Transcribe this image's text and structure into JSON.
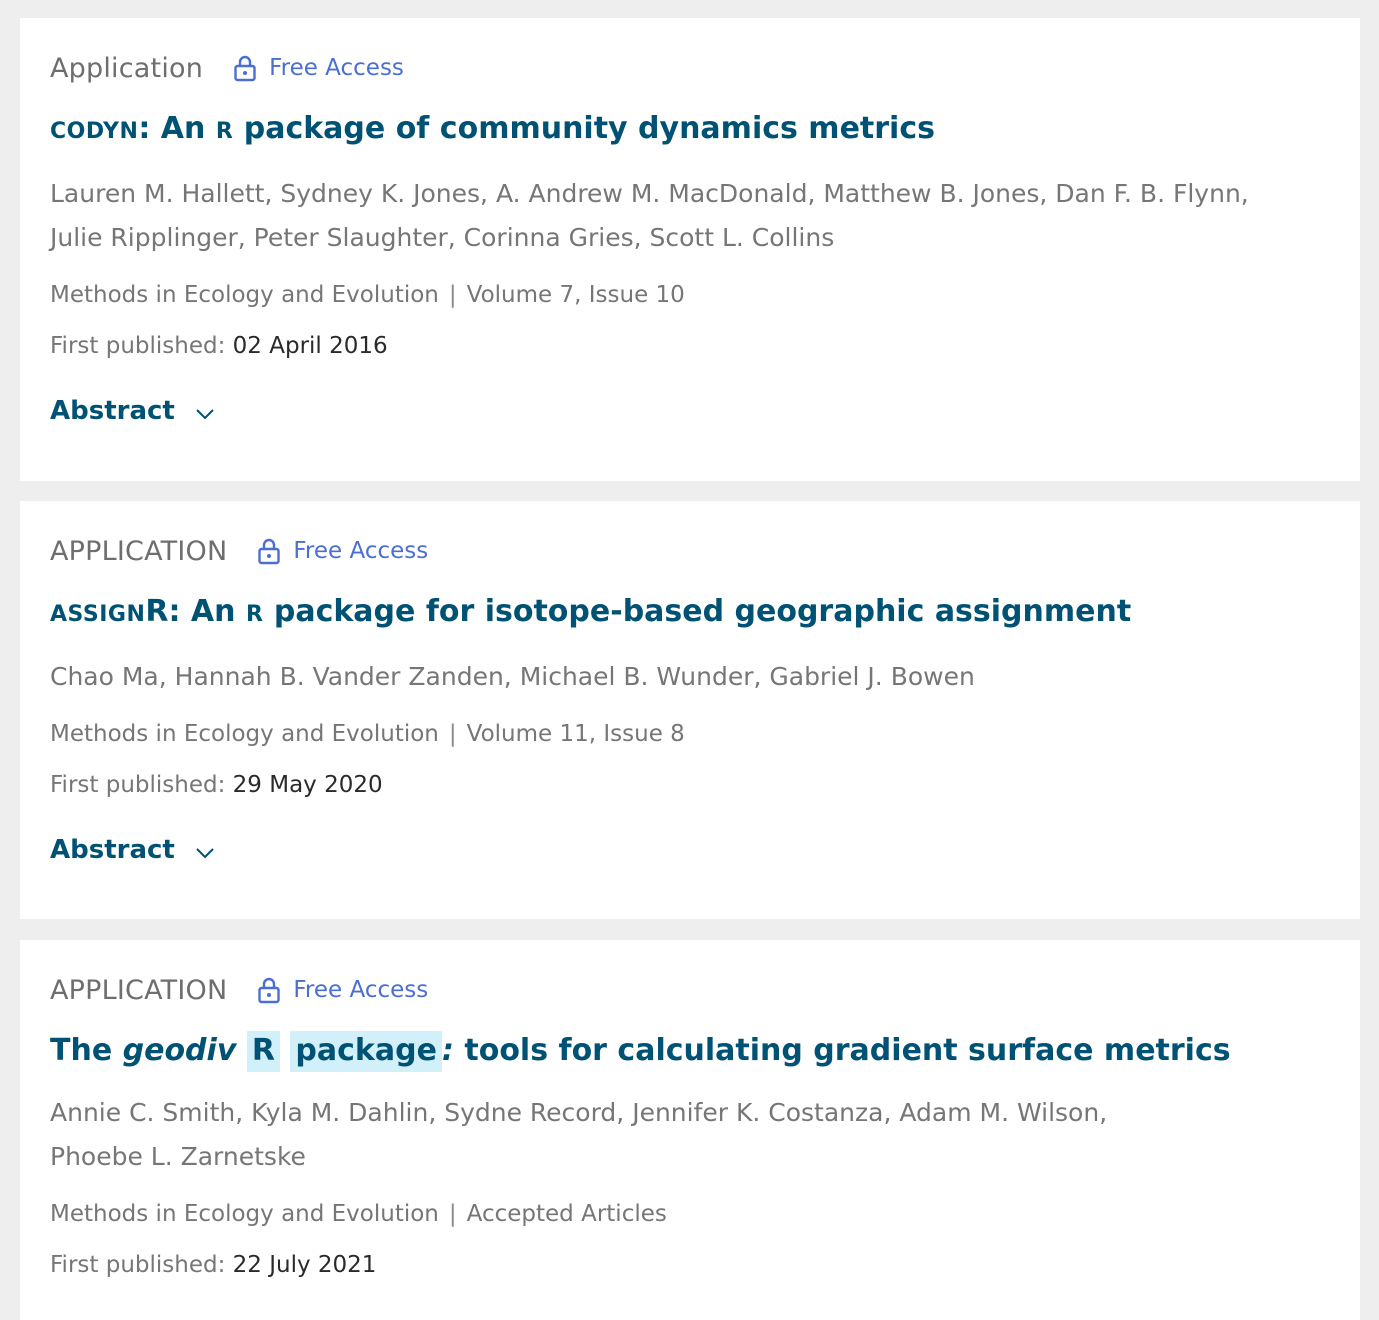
{
  "articles": [
    {
      "type": "Application",
      "access": "Free Access",
      "title_parts": {
        "sc": "CODYN",
        "mid": ": An ",
        "r": "R",
        "rest": " package of community dynamics metrics"
      },
      "authors_line1": "Lauren M. Hallett, Sydney K. Jones, A. Andrew M. MacDonald, Matthew B. Jones, Dan F. B. Flynn,",
      "authors_line2": "Julie Ripplinger, Peter Slaughter, Corinna Gries, Scott L. Collins",
      "journal": "Methods in Ecology and Evolution",
      "issue": "Volume 7, Issue 10",
      "published_label": "First published:",
      "published_date": "02 April 2016",
      "abstract_label": "Abstract"
    },
    {
      "type": "APPLICATION",
      "access": "Free Access",
      "title_parts": {
        "sc": "ASSIGN",
        "mid": "R: An ",
        "r": "R",
        "rest": " package for isotope-based geographic assignment"
      },
      "authors_line1": "Chao Ma, Hannah B. Vander Zanden, Michael B. Wunder, Gabriel J. Bowen",
      "journal": "Methods in Ecology and Evolution",
      "issue": "Volume 11, Issue 8",
      "published_label": "First published:",
      "published_date": "29 May 2020",
      "abstract_label": "Abstract"
    },
    {
      "type": "APPLICATION",
      "access": "Free Access",
      "title_parts": {
        "pre": "The ",
        "italic": "geodiv",
        "hl1": "R",
        "hl2": "package",
        "colon": ":",
        "rest": " tools for calculating gradient surface metrics"
      },
      "authors_line1": "Annie C. Smith, Kyla M. Dahlin, Sydne Record, Jennifer K. Costanza, Adam M. Wilson,",
      "authors_line2": "Phoebe L. Zarnetske",
      "journal": "Methods in Ecology and Evolution",
      "issue": "Accepted Articles",
      "published_label": "First published:",
      "published_date": "22 July 2021"
    }
  ],
  "meta_separator": "|",
  "colors": {
    "title": "#005274",
    "access": "#4b6fd1",
    "highlight": "#d2f0fa",
    "background": "#eeeeee"
  },
  "icons": {
    "access": "lock-icon",
    "abstract": "chevron-down-icon"
  }
}
